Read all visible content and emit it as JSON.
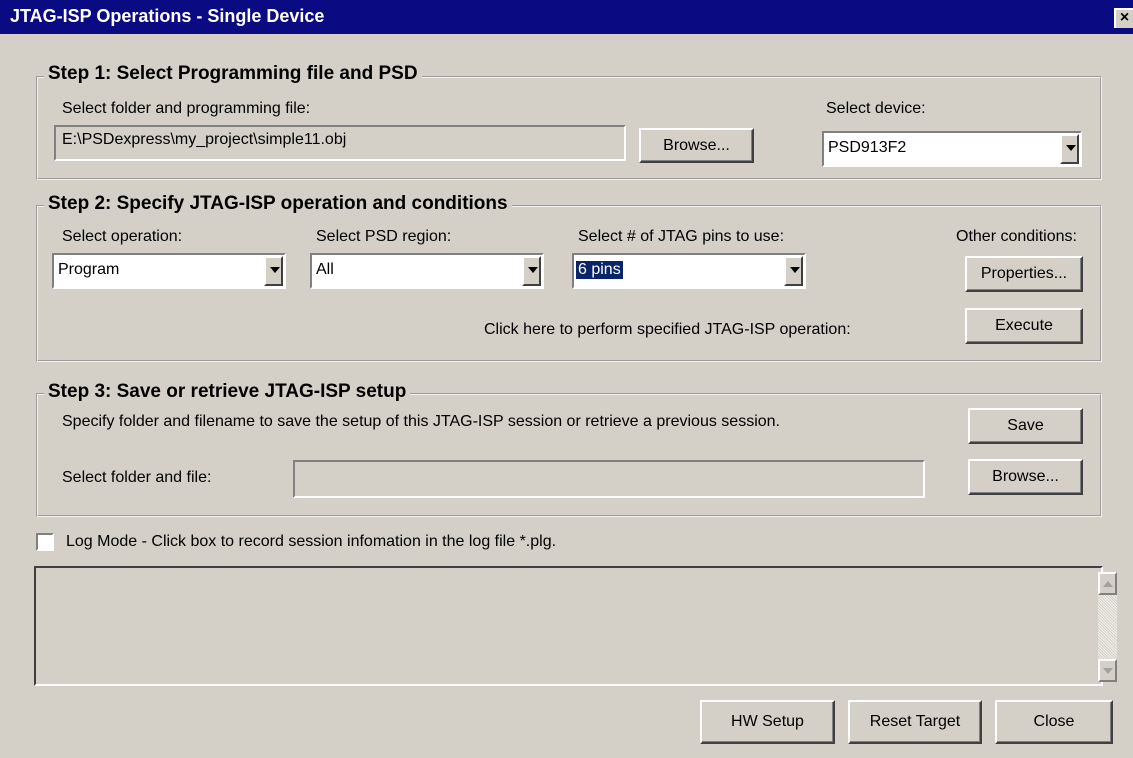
{
  "window": {
    "title": "JTAG-ISP Operations - Single Device",
    "close_glyph": "×"
  },
  "step1": {
    "title": "Step 1: Select Programming file and PSD",
    "file_label": "Select folder and programming file:",
    "file_value": "E:\\PSDexpress\\my_project\\simple11.obj",
    "browse_label": "Browse...",
    "device_label": "Select device:",
    "device_value": "PSD913F2"
  },
  "step2": {
    "title": "Step 2: Specify JTAG-ISP operation and conditions",
    "operation_label": "Select operation:",
    "operation_value": "Program",
    "region_label": "Select PSD region:",
    "region_value": "All",
    "pins_label": "Select # of JTAG pins to use:",
    "pins_value": "6 pins",
    "other_label": "Other conditions:",
    "properties_label": "Properties...",
    "execute_hint": "Click here to perform specified JTAG-ISP operation:",
    "execute_label": "Execute"
  },
  "step3": {
    "title": "Step 3: Save or retrieve JTAG-ISP setup",
    "description": "Specify folder and filename to save the setup of this JTAG-ISP session or retrieve a previous session.",
    "save_label": "Save",
    "file_label": "Select folder and file:",
    "file_value": "",
    "browse_label": "Browse..."
  },
  "log": {
    "checkbox_label": "Log Mode - Click box to record session infomation in the log file *.plg.",
    "checked": false
  },
  "footer": {
    "hw_setup_label": "HW Setup",
    "reset_target_label": "Reset Target",
    "close_label": "Close"
  }
}
